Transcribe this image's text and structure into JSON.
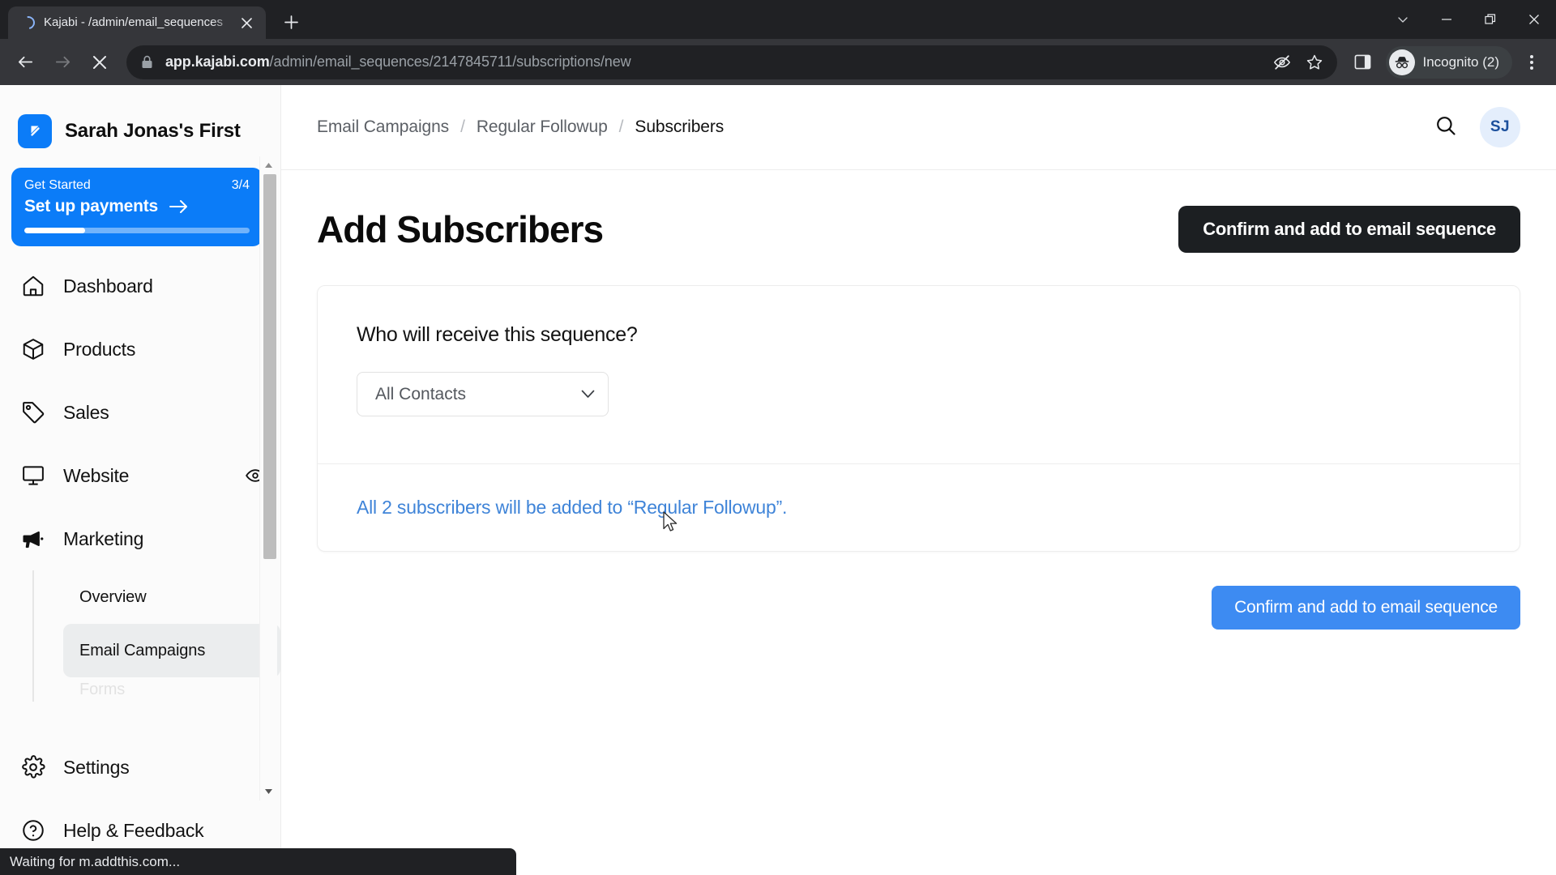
{
  "browser": {
    "tab": {
      "title": "Kajabi - /admin/email_sequences",
      "spinner_icon": "loading-spinner-icon",
      "close_icon": "close-icon"
    },
    "newtab_icon": "plus-icon",
    "window_controls": [
      {
        "name": "tab-search-button",
        "icon": "chevron-down-icon"
      },
      {
        "name": "minimize-button",
        "icon": "minimize-icon"
      },
      {
        "name": "maximize-button",
        "icon": "restore-icon"
      },
      {
        "name": "close-window-button",
        "icon": "close-icon"
      }
    ],
    "nav": {
      "back_icon": "arrow-left-icon",
      "forward_icon": "arrow-right-icon",
      "stop_icon": "stop-x-icon"
    },
    "omnibox": {
      "lock_icon": "lock-icon",
      "url_host": "app.kajabi.com",
      "url_path": "/admin/email_sequences/2147845711/subscriptions/new",
      "tracking_icon": "eye-slash-icon",
      "bookmark_icon": "star-icon"
    },
    "sidepanel_icon": "side-panel-icon",
    "profile": {
      "label": "Incognito (2)",
      "icon": "incognito-icon"
    },
    "menu_icon": "kebab-menu-icon",
    "status": "Waiting for m.addthis.com..."
  },
  "sidebar": {
    "brand": {
      "name": "Sarah Jonas's First",
      "logo_icon": "kajabi-logo-icon"
    },
    "get_started": {
      "label": "Get Started",
      "count": "3/4",
      "action": "Set up payments",
      "arrow_icon": "arrow-right-icon",
      "progress_percent": 27,
      "accent_color": "#0b7cf8"
    },
    "items": [
      {
        "label": "Dashboard",
        "icon": "home-icon",
        "active": false
      },
      {
        "label": "Products",
        "icon": "box-icon",
        "active": false
      },
      {
        "label": "Sales",
        "icon": "tag-icon",
        "active": false
      },
      {
        "label": "Website",
        "icon": "monitor-icon",
        "active": false,
        "trailing_icon": "eye-icon"
      },
      {
        "label": "Marketing",
        "icon": "megaphone-icon",
        "active": false,
        "expanded": true
      }
    ],
    "marketing_subitems": [
      {
        "label": "Overview",
        "active": false
      },
      {
        "label": "Email Campaigns",
        "active": true
      },
      {
        "label": "Forms",
        "active": false
      }
    ],
    "bottom_items": [
      {
        "label": "Settings",
        "icon": "gear-icon"
      },
      {
        "label": "Help & Feedback",
        "icon": "question-circle-icon"
      }
    ],
    "scrollbar": {
      "up_icon": "caret-up-icon",
      "down_icon": "caret-down-icon"
    }
  },
  "topbar": {
    "breadcrumb": [
      {
        "label": "Email Campaigns",
        "current": false
      },
      {
        "label": "Regular Followup",
        "current": false
      },
      {
        "label": "Subscribers",
        "current": true
      }
    ],
    "separator": "/",
    "search_icon": "search-icon",
    "avatar_initials": "SJ"
  },
  "main": {
    "page_title": "Add Subscribers",
    "primary_button_top": "Confirm and add to email sequence",
    "question": "Who will receive this sequence?",
    "audience_select": {
      "value": "All Contacts",
      "caret_icon": "chevron-down-icon",
      "options": [
        "All Contacts"
      ]
    },
    "note": "All 2 subscribers will be added to “Regular Followup”.",
    "note_color": "#3f84d8",
    "primary_button_bottom": "Confirm and add to email sequence",
    "primary_button_bottom_color": "#3d8bf2"
  }
}
